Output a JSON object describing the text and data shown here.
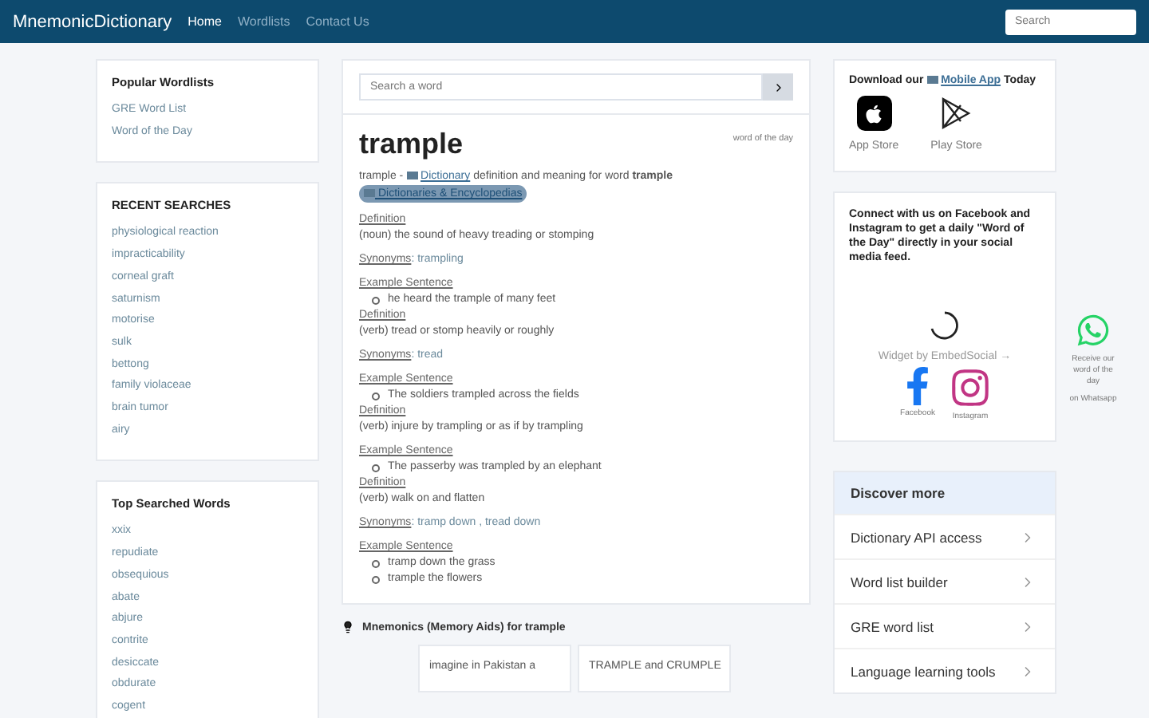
{
  "nav": {
    "brand": "MnemonicDictionary",
    "links": [
      {
        "label": "Home",
        "selected": true
      },
      {
        "label": "Wordlists",
        "selected": false
      },
      {
        "label": "Contact Us",
        "selected": false
      }
    ],
    "search": {
      "placeholder": "Search"
    }
  },
  "left": [
    {
      "title": "Popular Wordlists",
      "items": [
        "GRE Word List",
        "Word of the Day"
      ]
    },
    {
      "title": "RECENT SEARCHES",
      "items": [
        "physiological reaction",
        "impracticability",
        "corneal graft",
        "saturnism",
        "motorise",
        "sulk",
        "bettong",
        "family violaceae",
        "brain tumor",
        "airy"
      ]
    },
    {
      "title": "Top Searched Words",
      "items": [
        "xxix",
        "repudiate",
        "obsequious",
        "abate",
        "abjure",
        "contrite",
        "desiccate",
        "obdurate",
        "cogent"
      ]
    }
  ],
  "entry": {
    "search": {
      "placeholder": "Search a word"
    },
    "word": "trample",
    "tag": "word of the day",
    "intro_start": "trample - ",
    "intro_link": "Dictionary",
    "intro_rest": " definition and meaning for word **trample**",
    "chip": "Dictionaries & Encyclopedias",
    "senses": [
      {
        "kind": "definition",
        "label": "Definition",
        "text": "(noun) the sound of heavy treading or stomping"
      },
      {
        "kind": "synonyms",
        "label": "Synonyms",
        "text": " : trampling"
      },
      {
        "kind": "example",
        "label": "Example Sentence",
        "items": [
          "he heard the trample of many feet"
        ]
      },
      {
        "kind": "definition",
        "label": "Definition",
        "text": "(verb) tread or stomp heavily or roughly"
      },
      {
        "kind": "synonyms",
        "label": "Synonyms",
        "text": " : tread"
      },
      {
        "kind": "example",
        "label": "Example Sentence",
        "items": [
          "The soldiers trampled across the fields"
        ]
      },
      {
        "kind": "definition",
        "label": "Definition",
        "text": "(verb) injure by trampling or as if by trampling"
      },
      {
        "kind": "example",
        "label": "Example Sentence",
        "items": [
          "The passerby was trampled by an elephant"
        ]
      },
      {
        "kind": "definition",
        "label": "Definition",
        "text": "(verb) walk on and flatten"
      },
      {
        "kind": "synonyms",
        "label": "Synonyms",
        "text": " : tramp down , tread down"
      },
      {
        "kind": "example",
        "label": "Example Sentence",
        "items": [
          "tramp down the grass",
          "trample the flowers"
        ]
      }
    ]
  },
  "mnemonics": {
    "title": "Mnemonics (Memory Aids) for trample",
    "cards": [
      "imagine in Pakistan a",
      "TRAMPLE and CRUMPLE"
    ]
  },
  "app": {
    "start": "Download our ",
    "link": "Mobile App",
    "end": " Today",
    "stores": [
      {
        "kind": "apple",
        "label": "App Store"
      },
      {
        "kind": "play",
        "label": "Play Store"
      }
    ]
  },
  "social": {
    "text": "Connect with us on Facebook and Instagram to get a daily \"Word of the Day\" directly in your social media feed.",
    "widget": "Widget by EmbedSocial →",
    "links": [
      {
        "kind": "facebook",
        "label": "Facebook"
      },
      {
        "kind": "instagram",
        "label": "Instagram"
      }
    ]
  },
  "discover": {
    "title": "Discover more",
    "items": [
      "Dictionary API access",
      "Word list builder",
      "GRE word list",
      "Language learning tools"
    ]
  },
  "whatsapp": {
    "lines": [
      "Receive our word of the day",
      "on Whatsapp"
    ]
  }
}
